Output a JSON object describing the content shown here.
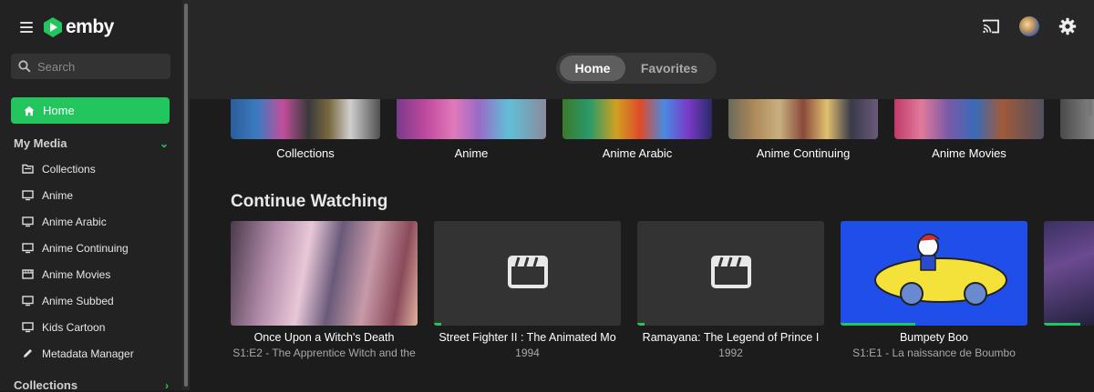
{
  "brand": {
    "name": "emby"
  },
  "search": {
    "placeholder": "Search"
  },
  "nav": {
    "home_label": "Home",
    "my_media": {
      "title": "My Media",
      "items": [
        {
          "label": "Collections",
          "icon": "folder-icon"
        },
        {
          "label": "Anime",
          "icon": "monitor-icon"
        },
        {
          "label": "Anime Arabic",
          "icon": "monitor-icon"
        },
        {
          "label": "Anime Continuing",
          "icon": "monitor-icon"
        },
        {
          "label": "Anime Movies",
          "icon": "film-icon"
        },
        {
          "label": "Anime Subbed",
          "icon": "monitor-icon"
        },
        {
          "label": "Kids Cartoon",
          "icon": "monitor-icon"
        },
        {
          "label": "Metadata Manager",
          "icon": "pencil-icon"
        }
      ]
    },
    "collections": {
      "title": "Collections"
    }
  },
  "tabs": [
    {
      "label": "Home",
      "active": true
    },
    {
      "label": "Favorites",
      "active": false
    }
  ],
  "libraries": [
    {
      "label": "Collections"
    },
    {
      "label": "Anime"
    },
    {
      "label": "Anime Arabic"
    },
    {
      "label": "Anime Continuing"
    },
    {
      "label": "Anime Movies"
    }
  ],
  "continue_watching": {
    "title": "Continue Watching",
    "items": [
      {
        "title": "Once Upon a Witch's Death",
        "subtitle": "S1:E2 - The Apprentice Witch and the",
        "progress": 0.0
      },
      {
        "title": "Street Fighter II : The Animated Mo",
        "subtitle": "1994",
        "progress": 0.04
      },
      {
        "title": "Ramayana: The Legend of Prince I",
        "subtitle": "1992",
        "progress": 0.04
      },
      {
        "title": "Bumpety Boo",
        "subtitle": "S1:E1 - La naissance de Boumbo",
        "progress": 0.4
      }
    ]
  },
  "colors": {
    "accent": "#22c55e",
    "background": "#1c1c1c",
    "sidebar": "#222222"
  }
}
